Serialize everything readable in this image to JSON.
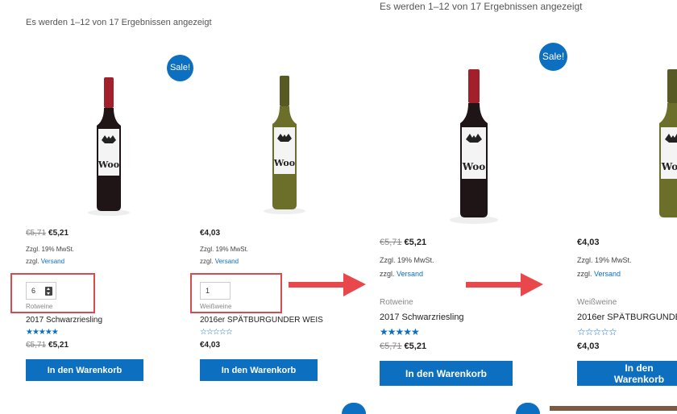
{
  "colors": {
    "accent": "#0c6fc0",
    "highlight": "#d9494e",
    "red_wine": "#5a0d15",
    "white_wine": "#6b6f2a"
  },
  "results_text": "Es werden 1–12 von 17 Ergebnissen angezeigt",
  "sale_label": "Sale!",
  "add_to_cart": "In den Warenkorb",
  "tax_note": "Zzgl. 19% MwSt.",
  "shipping_prefix": "zzgl.",
  "shipping_link": "Versand",
  "products": [
    {
      "name": "2017 Schwarzriesling",
      "category": "Rotweine",
      "old_price": "€5,71",
      "price": "€5,21",
      "rating_stars": "★★★★★",
      "on_sale": true,
      "quantity": "6"
    },
    {
      "name": "2016er SPÄTBURGUNDER WEIS",
      "category": "Weißweine",
      "price": "€4,03",
      "rating_stars": "☆☆☆☆☆",
      "on_sale": false,
      "quantity": "1"
    }
  ],
  "right_products": [
    {
      "name": "2017 Schwarzriesling",
      "category": "Rotweine"
    },
    {
      "name": "2016er SPÄTBURGUNDE",
      "category": "Weißweine"
    }
  ],
  "icons": [
    "wine-bottle-icon",
    "arrow-right-icon",
    "spin-button-icon"
  ]
}
